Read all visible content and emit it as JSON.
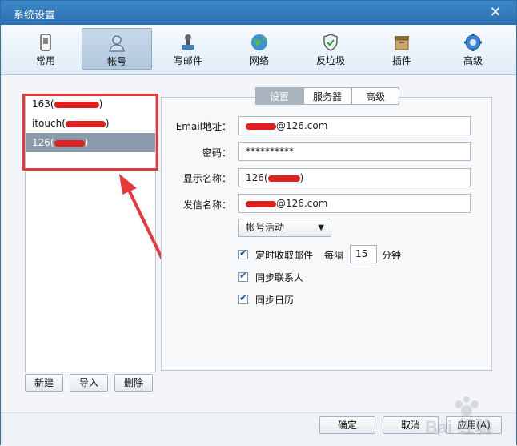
{
  "window": {
    "title": "系统设置"
  },
  "toolbar": {
    "items": [
      {
        "label": "常用",
        "icon": "phone-icon"
      },
      {
        "label": "帐号",
        "icon": "user-icon",
        "active": true
      },
      {
        "label": "写邮件",
        "icon": "stamp-icon"
      },
      {
        "label": "网络",
        "icon": "globe-icon"
      },
      {
        "label": "反垃圾",
        "icon": "shield-icon"
      },
      {
        "label": "插件",
        "icon": "box-icon"
      },
      {
        "label": "高级",
        "icon": "gear-icon"
      }
    ]
  },
  "accounts": {
    "items": [
      {
        "label": "163(",
        "suffix": ")"
      },
      {
        "label": "itouch(",
        "suffix": ")"
      },
      {
        "label": "126(",
        "suffix": ")",
        "selected": true
      }
    ],
    "new_label": "新建",
    "import_label": "导入",
    "delete_label": "删除"
  },
  "tabs": [
    {
      "label": "设置",
      "active": true
    },
    {
      "label": "服务器"
    },
    {
      "label": "高级"
    }
  ],
  "form": {
    "email_label": "Email地址：",
    "email_value": "@126.com",
    "password_label": "密码：",
    "password_value": "**********",
    "display_label": "显示名称：",
    "display_value": "126(",
    "display_suffix": ")",
    "sender_label": "发信名称：",
    "sender_value": "@126.com",
    "status_select": "帐号活动",
    "timed_label": "定时收取邮件",
    "every_label": "每隔",
    "interval_value": "15",
    "minute_label": "分钟",
    "sync_contacts_label": "同步联系人",
    "sync_calendar_label": "同步日历"
  },
  "footer": {
    "ok_label": "确定",
    "cancel_label": "取消",
    "apply_label": "应用(A)"
  },
  "watermark": {
    "text": "Bai 经验"
  },
  "colors": {
    "titlebar": "#2b70b0",
    "annotation": "#e53a3a",
    "selection": "#8a9aaa"
  }
}
